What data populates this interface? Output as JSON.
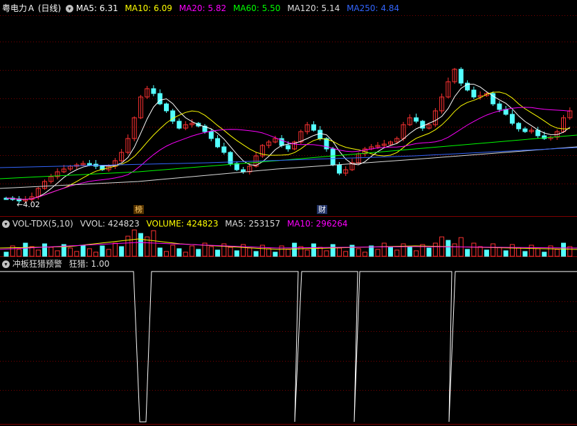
{
  "price_panel": {
    "stock_title": "粤电力Ａ (日线)",
    "indicators": [
      {
        "label": "MA5: 6.31",
        "color": "#ffffff"
      },
      {
        "label": "MA10: 6.09",
        "color": "#ffff00"
      },
      {
        "label": "MA20: 5.82",
        "color": "#ff00ff"
      },
      {
        "label": "MA60: 5.50",
        "color": "#00ff00"
      },
      {
        "label": "MA120: 5.14",
        "color": "#dddddd"
      },
      {
        "label": "MA250: 4.84",
        "color": "#3366ff"
      }
    ],
    "low_marker": "4.02",
    "event_tags": [
      {
        "text": "榜",
        "color": "#ffcc66",
        "bg": "#553300"
      },
      {
        "text": "财",
        "color": "#ffffff",
        "bg": "#223366"
      }
    ]
  },
  "volume_panel": {
    "title": "VOL-TDX(5,10)",
    "items": [
      {
        "label": "VVOL: 424823",
        "color": "#dddddd"
      },
      {
        "label": "VOLUME: 424823",
        "color": "#ffff00"
      },
      {
        "label": "MA5: 253157",
        "color": "#dddddd"
      },
      {
        "label": "MA10: 296264",
        "color": "#ff00ff"
      }
    ]
  },
  "signal_panel": {
    "title": "冲板狂猎预警",
    "value_label": "狂猎: 1.00"
  },
  "colors": {
    "up": "#ff3232",
    "down": "#54ffff",
    "grid": "#800000",
    "signal": "#ffffff"
  },
  "icons": {
    "menu": "circle-down-icon"
  }
}
